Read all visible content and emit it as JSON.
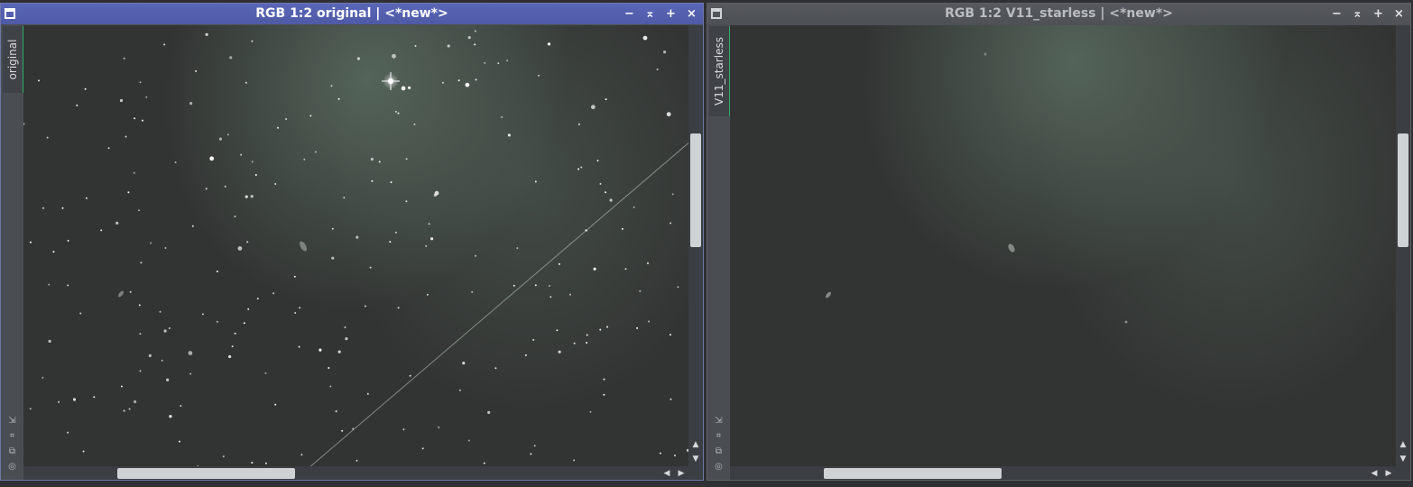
{
  "windows": [
    {
      "title": "RGB 1:2 original | <*new*>",
      "view_tab": "original",
      "icons": {
        "menu": "window-menu-icon",
        "minimize": "minimize-icon",
        "shade": "shade-icon",
        "maximize": "maximize-icon",
        "close": "close-icon"
      },
      "ctrl_glyphs": [
        "−",
        "⌅",
        "+",
        "×"
      ],
      "tool_glyphs": [
        "⇲",
        "⌗",
        "⧉",
        "◎"
      ],
      "scroll_glyphs": {
        "up": "▲",
        "down": "▼",
        "left": "◀",
        "right": "▶"
      },
      "active": true,
      "content": "star-field"
    },
    {
      "title": "RGB 1:2 V11_starless | <*new*>",
      "view_tab": "V11_starless",
      "icons": {
        "menu": "window-menu-icon",
        "minimize": "minimize-icon",
        "shade": "shade-icon",
        "maximize": "maximize-icon",
        "close": "close-icon"
      },
      "ctrl_glyphs": [
        "−",
        "⌅",
        "+",
        "×"
      ],
      "tool_glyphs": [
        "⇲",
        "⌗",
        "⧉",
        "◎"
      ],
      "scroll_glyphs": {
        "up": "▲",
        "down": "▼",
        "left": "◀",
        "right": "▶"
      },
      "active": false,
      "content": "starless-field"
    }
  ],
  "colors": {
    "active_title": "#5a67b7",
    "inactive_title": "#56595e",
    "view_tab_accent": "#2fae6a",
    "sky_background": "#323433",
    "nebula_glow": "#6f8a78"
  }
}
